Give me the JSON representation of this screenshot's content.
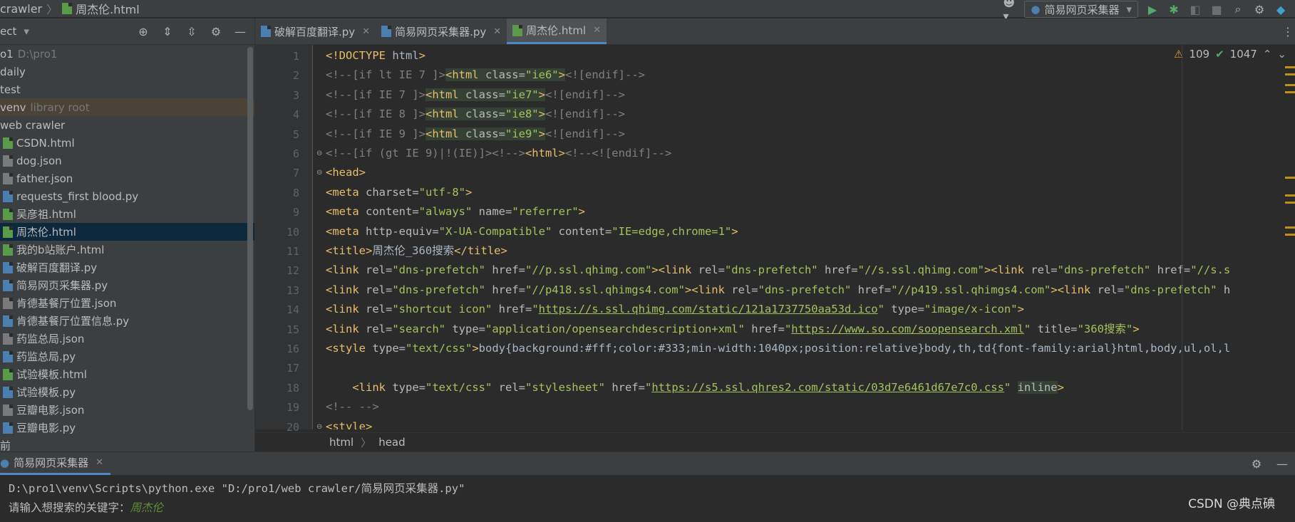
{
  "navbar": {
    "crumbs": [
      "crawler",
      "周杰伦.html"
    ],
    "run_config": "简易网页采集器"
  },
  "project": {
    "header_label": "ect",
    "tree": [
      {
        "label": "o1",
        "hint": "D:\\pro1",
        "indent": 0,
        "icon": "folder-icon"
      },
      {
        "label": "daily",
        "hint": "",
        "indent": 0,
        "icon": "folder-icon"
      },
      {
        "label": "test",
        "hint": "",
        "indent": 0,
        "icon": "folder-icon"
      },
      {
        "label": "venv",
        "hint": "library root",
        "indent": 0,
        "icon": "folder-icon",
        "venv": true
      },
      {
        "label": "web crawler",
        "hint": "",
        "indent": 0,
        "icon": "folder-icon"
      },
      {
        "label": "CSDN.html",
        "hint": "",
        "indent": 1,
        "icon": "html"
      },
      {
        "label": "dog.json",
        "hint": "",
        "indent": 1,
        "icon": "json"
      },
      {
        "label": "father.json",
        "hint": "",
        "indent": 1,
        "icon": "json"
      },
      {
        "label": "requests_first blood.py",
        "hint": "",
        "indent": 1,
        "icon": "py"
      },
      {
        "label": "吴彦祖.html",
        "hint": "",
        "indent": 1,
        "icon": "html"
      },
      {
        "label": "周杰伦.html",
        "hint": "",
        "indent": 1,
        "icon": "html",
        "selected": true
      },
      {
        "label": "我的b站账户.html",
        "hint": "",
        "indent": 1,
        "icon": "html"
      },
      {
        "label": "破解百度翻译.py",
        "hint": "",
        "indent": 1,
        "icon": "py"
      },
      {
        "label": "简易网页采集器.py",
        "hint": "",
        "indent": 1,
        "icon": "py"
      },
      {
        "label": "肯德基餐厅位置.json",
        "hint": "",
        "indent": 1,
        "icon": "json"
      },
      {
        "label": "肯德基餐厅位置信息.py",
        "hint": "",
        "indent": 1,
        "icon": "py"
      },
      {
        "label": "药监总局.json",
        "hint": "",
        "indent": 1,
        "icon": "json"
      },
      {
        "label": "药监总局.py",
        "hint": "",
        "indent": 1,
        "icon": "py"
      },
      {
        "label": "试验模板.html",
        "hint": "",
        "indent": 1,
        "icon": "html"
      },
      {
        "label": "试验模板.py",
        "hint": "",
        "indent": 1,
        "icon": "py"
      },
      {
        "label": "豆瓣电影.json",
        "hint": "",
        "indent": 1,
        "icon": "json"
      },
      {
        "label": "豆瓣电影.py",
        "hint": "",
        "indent": 1,
        "icon": "py"
      },
      {
        "label": "前",
        "hint": "",
        "indent": 0,
        "icon": ""
      }
    ]
  },
  "tabs": [
    {
      "label": "破解百度翻译.py",
      "icon": "py",
      "active": false
    },
    {
      "label": "简易网页采集器.py",
      "icon": "py",
      "active": false
    },
    {
      "label": "周杰伦.html",
      "icon": "html",
      "active": true
    }
  ],
  "inspections": {
    "warnings": "109",
    "ok": "1047"
  },
  "line_numbers": [
    "1",
    "2",
    "3",
    "4",
    "5",
    "6",
    "7",
    "8",
    "9",
    "10",
    "11",
    "12",
    "13",
    "14",
    "15",
    "16",
    "17",
    "18",
    "19",
    "20"
  ],
  "code": [
    [
      [
        "tag",
        "<!DOCTYPE "
      ],
      [
        "txt",
        "html"
      ],
      [
        "tag",
        ">"
      ]
    ],
    [
      [
        "cmt",
        "<!--[if lt IE 7 ]>"
      ],
      [
        "tag hl",
        "<html "
      ],
      [
        "attr hl",
        "class="
      ],
      [
        "val hl",
        "\"ie6\""
      ],
      [
        "tag hl",
        ">"
      ],
      [
        "cmt",
        "<![endif]-->"
      ]
    ],
    [
      [
        "cmt",
        "<!--[if IE 7 ]>"
      ],
      [
        "tag hl",
        "<html "
      ],
      [
        "attr hl",
        "class="
      ],
      [
        "val hl",
        "\"ie7\""
      ],
      [
        "tag hl",
        ">"
      ],
      [
        "cmt",
        "<![endif]-->"
      ]
    ],
    [
      [
        "cmt",
        "<!--[if IE 8 ]>"
      ],
      [
        "tag hl",
        "<html "
      ],
      [
        "attr hl",
        "class="
      ],
      [
        "val hl",
        "\"ie8\""
      ],
      [
        "tag hl",
        ">"
      ],
      [
        "cmt",
        "<![endif]-->"
      ]
    ],
    [
      [
        "cmt",
        "<!--[if IE 9 ]>"
      ],
      [
        "tag hl",
        "<html "
      ],
      [
        "attr hl",
        "class="
      ],
      [
        "val hl",
        "\"ie9\""
      ],
      [
        "tag hl",
        ">"
      ],
      [
        "cmt",
        "<![endif]-->"
      ]
    ],
    [
      [
        "cmt",
        "<!--[if (gt IE 9)|!(IE)]><!-->"
      ],
      [
        "tag",
        "<html>"
      ],
      [
        "cmt",
        "<!--<![endif]-->"
      ]
    ],
    [
      [
        "tag",
        "<head>"
      ]
    ],
    [
      [
        "tag",
        "<meta "
      ],
      [
        "attr",
        "charset="
      ],
      [
        "val",
        "\"utf-8\""
      ],
      [
        "tag",
        ">"
      ]
    ],
    [
      [
        "tag",
        "<meta "
      ],
      [
        "attr",
        "content="
      ],
      [
        "val",
        "\"always\" "
      ],
      [
        "attr",
        "name="
      ],
      [
        "val",
        "\"referrer\""
      ],
      [
        "tag",
        ">"
      ]
    ],
    [
      [
        "tag",
        "<meta "
      ],
      [
        "attr",
        "http-equiv="
      ],
      [
        "val",
        "\"X-UA-Compatible\" "
      ],
      [
        "attr",
        "content="
      ],
      [
        "val",
        "\"IE=edge,chrome=1\""
      ],
      [
        "tag",
        ">"
      ]
    ],
    [
      [
        "tag",
        "<title>"
      ],
      [
        "txt",
        "周杰伦_360搜索"
      ],
      [
        "tag",
        "</title>"
      ]
    ],
    [
      [
        "tag",
        "<link "
      ],
      [
        "attr",
        "rel="
      ],
      [
        "val",
        "\"dns-prefetch\" "
      ],
      [
        "attr",
        "href="
      ],
      [
        "val",
        "\"//p.ssl.qhimg.com\""
      ],
      [
        "tag",
        ">"
      ],
      [
        "tag",
        "<link "
      ],
      [
        "attr",
        "rel="
      ],
      [
        "val",
        "\"dns-prefetch\" "
      ],
      [
        "attr",
        "href="
      ],
      [
        "val",
        "\"//s.ssl.qhimg.com\""
      ],
      [
        "tag",
        ">"
      ],
      [
        "tag",
        "<link "
      ],
      [
        "attr",
        "rel="
      ],
      [
        "val",
        "\"dns-prefetch\" "
      ],
      [
        "attr",
        "href="
      ],
      [
        "val",
        "\"//s.s"
      ]
    ],
    [
      [
        "tag",
        "<link "
      ],
      [
        "attr",
        "rel="
      ],
      [
        "val",
        "\"dns-prefetch\" "
      ],
      [
        "attr",
        "href="
      ],
      [
        "val",
        "\"//p418.ssl.qhimgs4.com\""
      ],
      [
        "tag",
        ">"
      ],
      [
        "tag",
        "<link "
      ],
      [
        "attr",
        "rel="
      ],
      [
        "val",
        "\"dns-prefetch\" "
      ],
      [
        "attr",
        "href="
      ],
      [
        "val",
        "\"//p419.ssl.qhimgs4.com\""
      ],
      [
        "tag",
        ">"
      ],
      [
        "tag",
        "<link "
      ],
      [
        "attr",
        "rel="
      ],
      [
        "val",
        "\"dns-prefetch\" "
      ],
      [
        "attr",
        "h"
      ]
    ],
    [
      [
        "tag",
        "<link "
      ],
      [
        "attr",
        "rel="
      ],
      [
        "val",
        "\"shortcut icon\" "
      ],
      [
        "attr",
        "href="
      ],
      [
        "val",
        "\""
      ],
      [
        "val u",
        "https://s.ssl.qhimg.com/static/121a1737750aa53d.ico"
      ],
      [
        "val",
        "\" "
      ],
      [
        "attr",
        "type="
      ],
      [
        "val",
        "\"image/x-icon\""
      ],
      [
        "tag",
        ">"
      ]
    ],
    [
      [
        "tag",
        "<link "
      ],
      [
        "attr",
        "rel="
      ],
      [
        "val",
        "\"search\" "
      ],
      [
        "attr",
        "type="
      ],
      [
        "val",
        "\"application/opensearchdescription+xml\" "
      ],
      [
        "attr",
        "href="
      ],
      [
        "val",
        "\""
      ],
      [
        "val u",
        "https://www.so.com/soopensearch.xml"
      ],
      [
        "val",
        "\" "
      ],
      [
        "attr",
        "title="
      ],
      [
        "val",
        "\"360搜索\""
      ],
      [
        "tag",
        ">"
      ]
    ],
    [
      [
        "tag",
        "<style "
      ],
      [
        "attr",
        "type="
      ],
      [
        "val",
        "\"text/css\""
      ],
      [
        "tag",
        ">"
      ],
      [
        "txt",
        "body{background:#fff;color:#333;min-width:1040px;position:relative}body,th,td{font-family:arial}html,body,ul,ol,l"
      ]
    ],
    [],
    [
      [
        "txt",
        "    "
      ],
      [
        "tag",
        "<link "
      ],
      [
        "attr",
        "type="
      ],
      [
        "val",
        "\"text/css\" "
      ],
      [
        "attr",
        "rel="
      ],
      [
        "val",
        "\"stylesheet\" "
      ],
      [
        "attr",
        "href="
      ],
      [
        "val",
        "\""
      ],
      [
        "val u",
        "https://s5.ssl.qhres2.com/static/03d7e6461d67e7c0.css"
      ],
      [
        "val",
        "\" "
      ],
      [
        "attr hl",
        "inline"
      ],
      [
        "tag",
        ">"
      ]
    ],
    [
      [
        "cmt",
        "<!-- -->"
      ]
    ],
    [
      [
        "tag",
        "<style>"
      ]
    ]
  ],
  "editor_crumbs": [
    "html",
    "head"
  ],
  "run": {
    "tab_label": "简易网页采集器",
    "command": "D:\\pro1\\venv\\Scripts\\python.exe \"D:/pro1/web crawler/简易网页采集器.py\"",
    "prompt": "请输入想搜索的关键字：",
    "input": "周杰伦"
  },
  "watermark": "CSDN @典点碘"
}
